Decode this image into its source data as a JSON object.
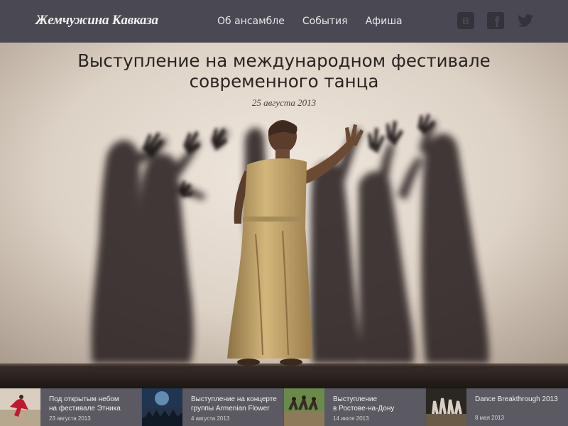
{
  "header": {
    "logo": "Жемчужина Кавказа",
    "nav": [
      "Об ансамбле",
      "События",
      "Афиша"
    ],
    "social": [
      {
        "icon": "vk-icon",
        "glyph": "В"
      },
      {
        "icon": "facebook-icon",
        "glyph": "f"
      },
      {
        "icon": "twitter-icon"
      }
    ]
  },
  "hero": {
    "title_lines": [
      "Выступление на международном фестивале",
      "современного танца"
    ],
    "date": "25 августа 2013"
  },
  "events": [
    {
      "title_lines": [
        "Под открытым небом",
        "на фестивале Этника"
      ],
      "date": "23 августа 2013"
    },
    {
      "title_lines": [
        "Выступление на концерте",
        "группы Armenian Flower"
      ],
      "date": "4 августа 2013"
    },
    {
      "title_lines": [
        "Выступление",
        "в Ростове-на-Дону"
      ],
      "date": "14 июля 2013"
    },
    {
      "title_lines": [
        "Dance Breakthrough 2013"
      ],
      "date": "8 мая 2013"
    }
  ],
  "colors": {
    "header_bg": "#4a4852",
    "strip_bg": "#5b5a62",
    "wall": "#e6ddd3"
  }
}
